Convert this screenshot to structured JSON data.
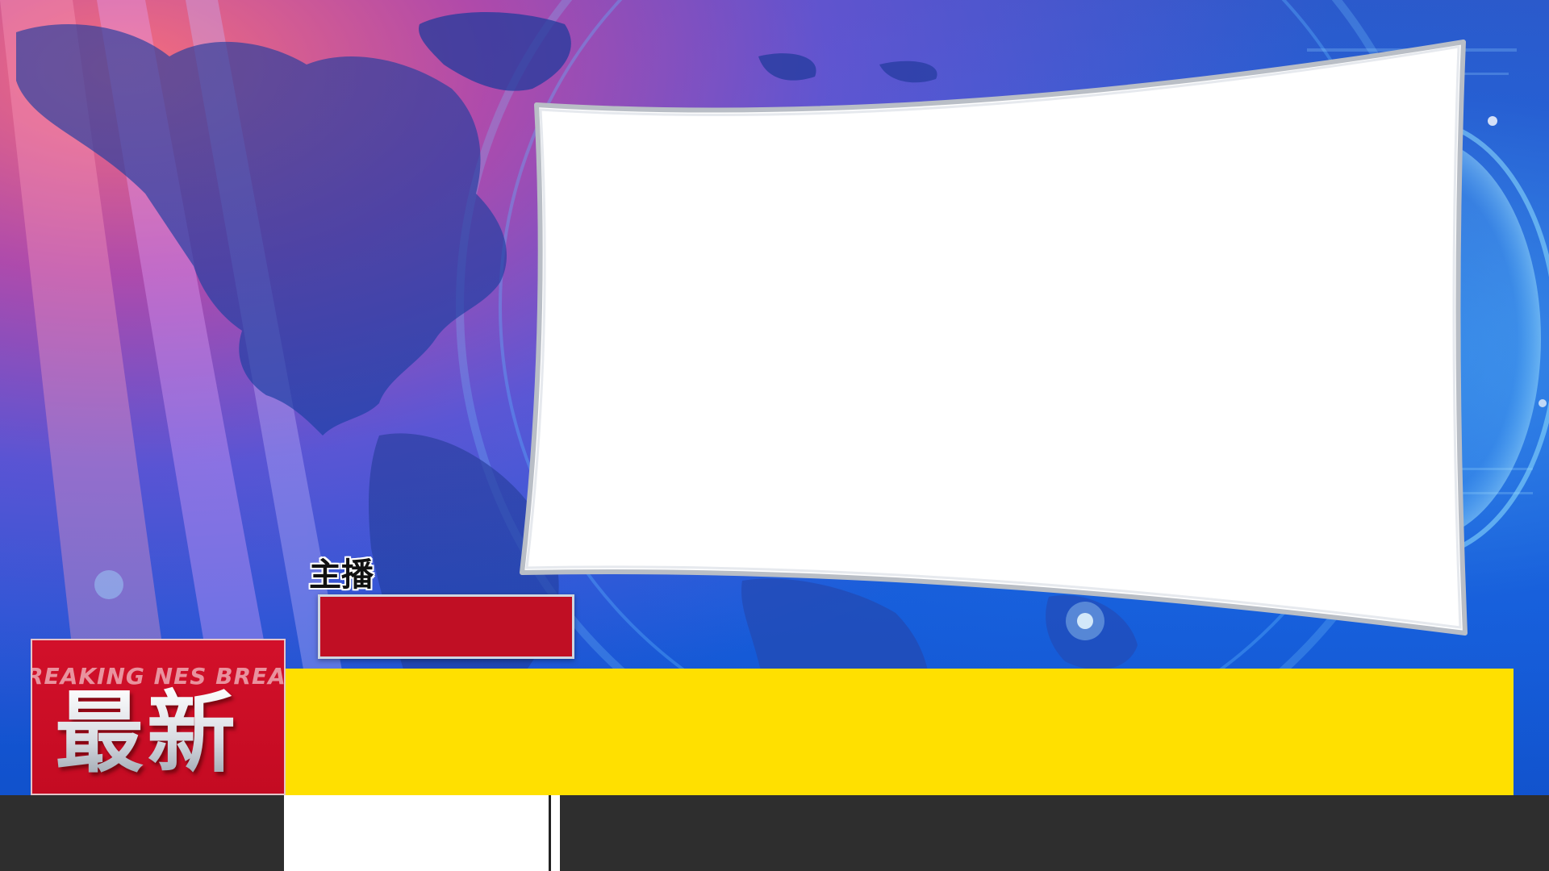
{
  "lower_third": {
    "anchor_label": "主播",
    "anchor_name": "",
    "badge_scroll_text": "REAKING NES   BREAK",
    "badge_title": "最新",
    "ticker_text": ""
  },
  "colors": {
    "badge_red": "#c40b22",
    "anchor_bar_red": "#c00f24",
    "ticker_yellow": "#ffe000",
    "bottom_bar_dark": "#2e2e2e",
    "screen_white": "#ffffff",
    "background_blue": "#1f5ad4"
  },
  "icons": {
    "background": "world-map-graphic",
    "screen": "video-screen-frame"
  }
}
